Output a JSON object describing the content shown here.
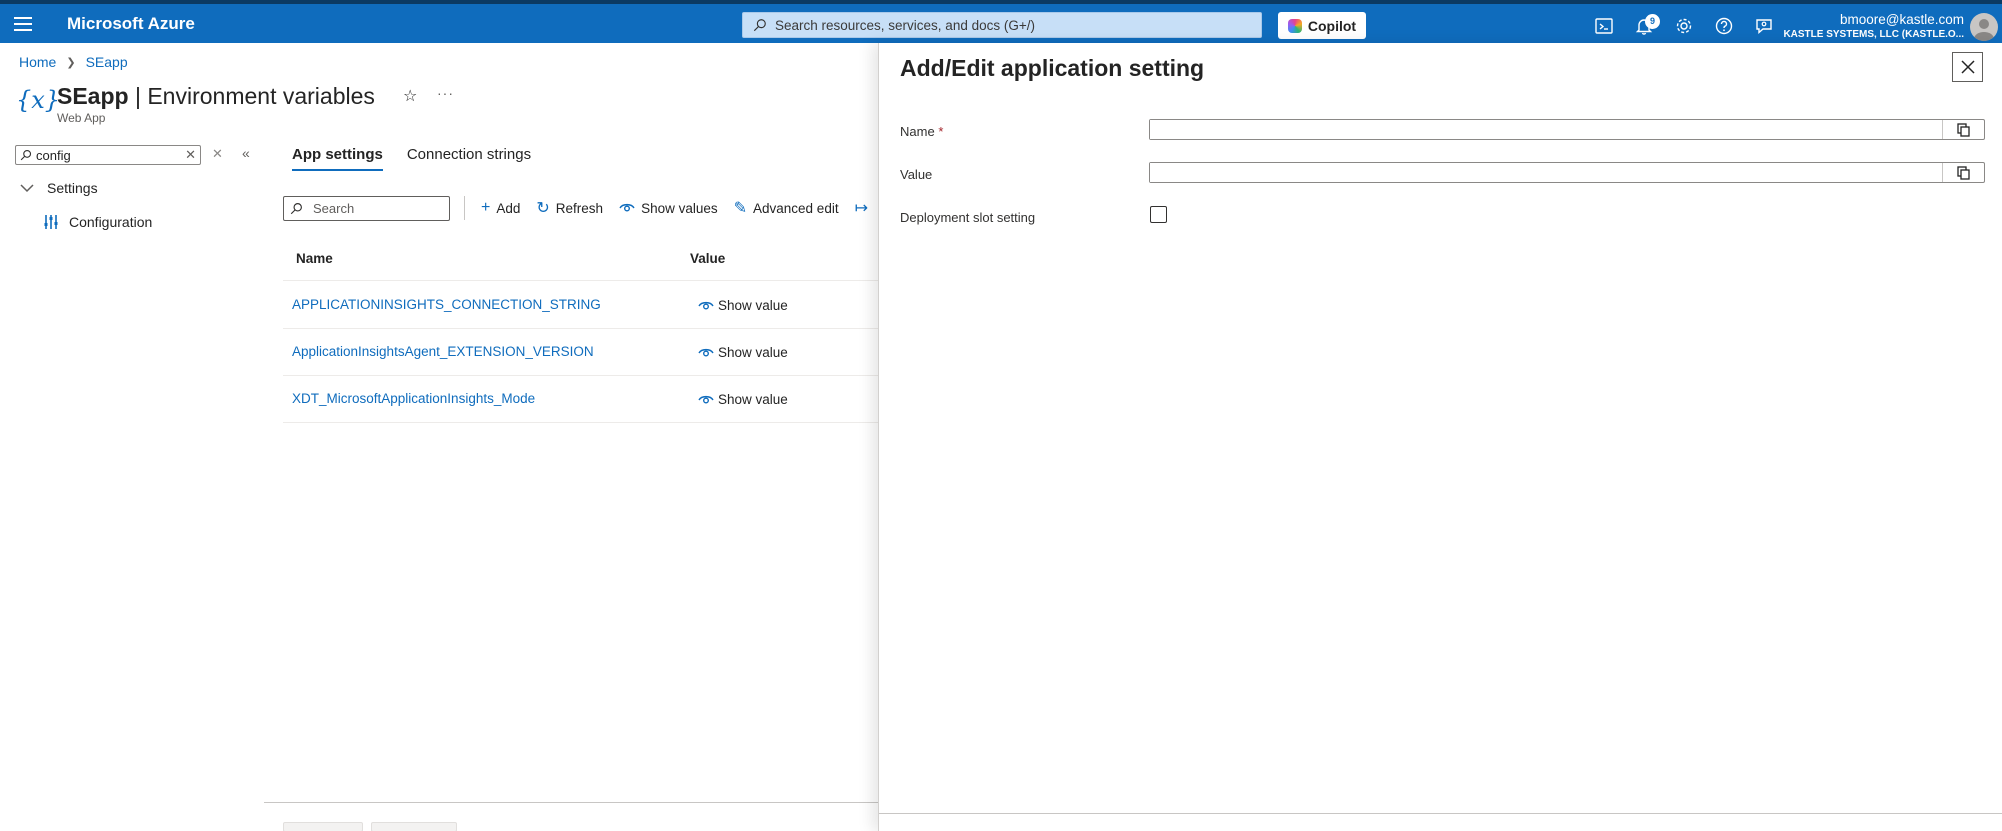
{
  "header": {
    "brand": "Microsoft Azure",
    "search_placeholder": "Search resources, services, and docs (G+/)",
    "copilot_label": "Copilot",
    "notification_count": "9",
    "user_email": "bmoore@kastle.com",
    "user_org": "KASTLE SYSTEMS, LLC (KASTLE.O..."
  },
  "breadcrumb": {
    "home": "Home",
    "resource": "SEapp"
  },
  "page": {
    "resource_name": "SEapp",
    "title_separator": " | ",
    "blade_name": "Environment variables",
    "subtitle": "Web App",
    "more_label": "···"
  },
  "sidebar": {
    "filter_value": "config",
    "group_label": "Settings",
    "items": [
      {
        "label": "Configuration"
      }
    ]
  },
  "tabs": [
    {
      "label": "App settings",
      "active": true
    },
    {
      "label": "Connection strings",
      "active": false
    }
  ],
  "toolbar": {
    "search_placeholder": "Search",
    "add_label": "Add",
    "refresh_label": "Refresh",
    "show_values_label": "Show values",
    "advanced_edit_label": "Advanced edit"
  },
  "grid": {
    "columns": [
      "Name",
      "Value"
    ],
    "rows": [
      {
        "name": "APPLICATIONINSIGHTS_CONNECTION_STRING",
        "value": "Show value"
      },
      {
        "name": "ApplicationInsightsAgent_EXTENSION_VERSION",
        "value": "Show value"
      },
      {
        "name": "XDT_MicrosoftApplicationInsights_Mode",
        "value": "Show value"
      }
    ]
  },
  "panel": {
    "title": "Add/Edit application setting",
    "name_label": "Name",
    "required_marker": "*",
    "value_label": "Value",
    "slot_label": "Deployment slot setting",
    "name_value": "",
    "value_value": "",
    "slot_checked": false
  },
  "colors": {
    "accent": "#0f6cbd",
    "topbar": "#0f6cbd",
    "link": "#0f6cbd"
  }
}
